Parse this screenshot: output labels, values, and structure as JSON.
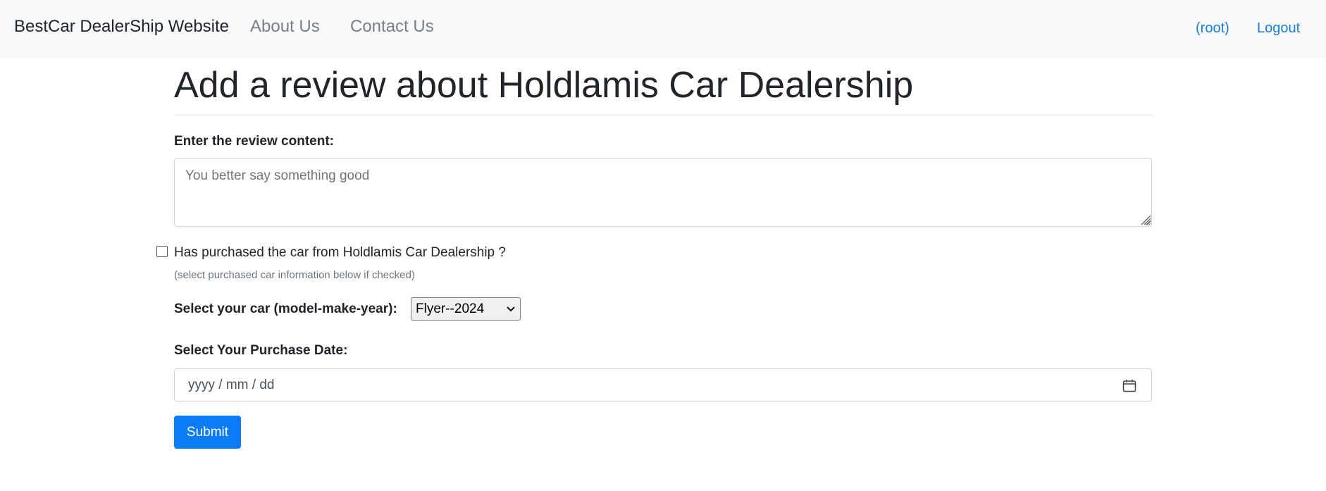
{
  "navbar": {
    "brand": "BestCar DealerShip Website",
    "links": [
      "About Us",
      "Contact Us"
    ],
    "user": "(root)",
    "logout": "Logout",
    "link_color": "#1a7fd4"
  },
  "page": {
    "title": "Add a review about Holdlamis Car Dealership"
  },
  "form": {
    "content_label": "Enter the review content:",
    "content_placeholder": "You better say something good",
    "content_value": "",
    "purchased_label": "Has purchased the car from Holdlamis Car Dealership ?",
    "purchased_checked": false,
    "purchased_hint": "(select purchased car information below if checked)",
    "car_label": "Select your car (model-make-year):",
    "car_selected": "Flyer--2024",
    "date_label": "Select Your Purchase Date:",
    "date_placeholder": "yyyy / mm / dd",
    "submit_label": "Submit",
    "accent_color": "#0a7cf8"
  },
  "icons": {
    "dropdown": "chevron-down-icon",
    "calendar": "calendar-icon",
    "resize": "resize-grip-icon"
  }
}
